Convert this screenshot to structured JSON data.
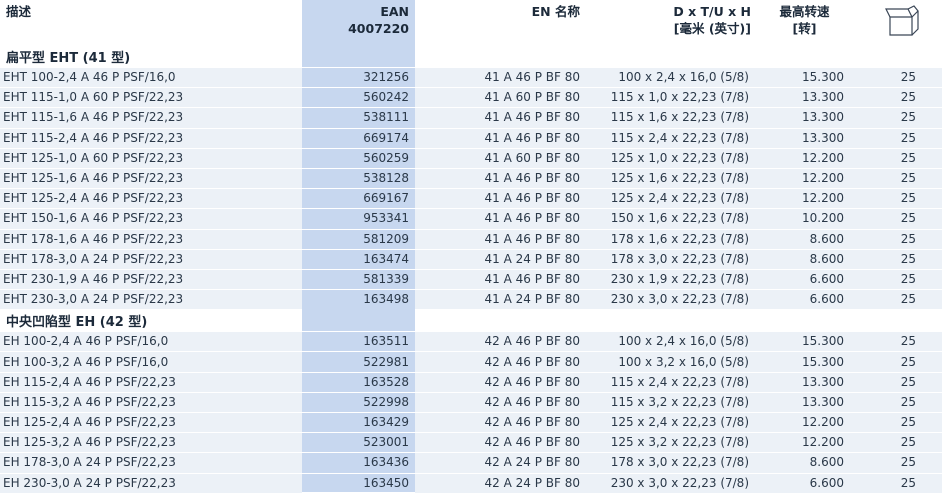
{
  "header": {
    "desc": "描述",
    "ean_top": "EAN",
    "ean_bottom": "4007220",
    "en": "EN 名称",
    "dim_top": "D x T/U x H",
    "dim_bottom": "[毫米 (英寸)]",
    "rpm_top": "最高转速",
    "rpm_bottom": "[转]",
    "pack_icon": "box-icon"
  },
  "groups": [
    {
      "title": "扁平型 EHT (41 型)",
      "rows": [
        [
          "EHT 100-2,4 A 46 P PSF/16,0",
          "321256",
          "41 A 46 P BF 80",
          "100 x 2,4 x 16,0 (5/8)",
          "15.300",
          "25"
        ],
        [
          "EHT 115-1,0 A 60 P PSF/22,23",
          "560242",
          "41 A 60 P BF 80",
          "115 x 1,0 x 22,23 (7/8)",
          "13.300",
          "25"
        ],
        [
          "EHT 115-1,6 A 46 P PSF/22,23",
          "538111",
          "41 A 46 P BF 80",
          "115 x 1,6 x 22,23 (7/8)",
          "13.300",
          "25"
        ],
        [
          "EHT 115-2,4 A 46 P PSF/22,23",
          "669174",
          "41 A 46 P BF 80",
          "115 x 2,4 x 22,23 (7/8)",
          "13.300",
          "25"
        ],
        [
          "EHT 125-1,0 A 60 P PSF/22,23",
          "560259",
          "41 A 60 P BF 80",
          "125 x 1,0 x 22,23 (7/8)",
          "12.200",
          "25"
        ],
        [
          "EHT 125-1,6 A 46 P PSF/22,23",
          "538128",
          "41 A 46 P BF 80",
          "125 x 1,6 x 22,23 (7/8)",
          "12.200",
          "25"
        ],
        [
          "EHT 125-2,4 A 46 P PSF/22,23",
          "669167",
          "41 A 46 P BF 80",
          "125 x 2,4 x 22,23 (7/8)",
          "12.200",
          "25"
        ],
        [
          "EHT 150-1,6 A 46 P PSF/22,23",
          "953341",
          "41 A 46 P BF 80",
          "150 x 1,6 x 22,23 (7/8)",
          "10.200",
          "25"
        ],
        [
          "EHT 178-1,6 A 46 P PSF/22,23",
          "581209",
          "41 A 46 P BF 80",
          "178 x 1,6 x 22,23 (7/8)",
          "8.600",
          "25"
        ],
        [
          "EHT 178-3,0 A 24 P PSF/22,23",
          "163474",
          "41 A 24 P BF 80",
          "178 x 3,0 x 22,23 (7/8)",
          "8.600",
          "25"
        ],
        [
          "EHT 230-1,9 A 46 P PSF/22,23",
          "581339",
          "41 A 46 P BF 80",
          "230 x 1,9 x 22,23 (7/8)",
          "6.600",
          "25"
        ],
        [
          "EHT 230-3,0 A 24 P PSF/22,23",
          "163498",
          "41 A 24 P BF 80",
          "230 x 3,0 x 22,23 (7/8)",
          "6.600",
          "25"
        ]
      ]
    },
    {
      "title": "中央凹陷型 EH (42 型)",
      "rows": [
        [
          "EH 100-2,4 A 46 P PSF/16,0",
          "163511",
          "42 A 46 P BF 80",
          "100 x 2,4 x 16,0 (5/8)",
          "15.300",
          "25"
        ],
        [
          "EH 100-3,2 A 46 P PSF/16,0",
          "522981",
          "42 A 46 P BF 80",
          "100 x 3,2 x 16,0 (5/8)",
          "15.300",
          "25"
        ],
        [
          "EH 115-2,4 A 46 P PSF/22,23",
          "163528",
          "42 A 46 P BF 80",
          "115 x 2,4 x 22,23 (7/8)",
          "13.300",
          "25"
        ],
        [
          "EH 115-3,2 A 46 P PSF/22,23",
          "522998",
          "42 A 46 P BF 80",
          "115 x 3,2 x 22,23 (7/8)",
          "13.300",
          "25"
        ],
        [
          "EH 125-2,4 A 46 P PSF/22,23",
          "163429",
          "42 A 46 P BF 80",
          "125 x 2,4 x 22,23 (7/8)",
          "12.200",
          "25"
        ],
        [
          "EH 125-3,2 A 46 P PSF/22,23",
          "523001",
          "42 A 46 P BF 80",
          "125 x 3,2 x 22,23 (7/8)",
          "12.200",
          "25"
        ],
        [
          "EH 178-3,0 A 24 P PSF/22,23",
          "163436",
          "42 A 24 P BF 80",
          "178 x 3,0 x 22,23 (7/8)",
          "8.600",
          "25"
        ],
        [
          "EH 230-3,0 A 24 P PSF/22,23",
          "163450",
          "42 A 24 P BF 80",
          "230 x 3,0 x 22,23 (7/8)",
          "6.600",
          "25"
        ]
      ]
    }
  ]
}
